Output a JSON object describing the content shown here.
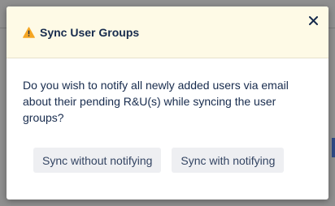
{
  "dialog": {
    "title": "Sync User Groups",
    "message": "Do you wish to notify all newly added users via email about their pending R&U(s) while syncing the user groups?",
    "buttons": {
      "sync_without": "Sync without notifying",
      "sync_with": "Sync with notifying"
    },
    "icons": {
      "warning": "warning-icon",
      "close": "close-icon"
    },
    "colors": {
      "header_bg": "#fefae6",
      "warning": "#f5a623",
      "text": "#172b4d",
      "button_bg": "#eeeff2"
    }
  }
}
